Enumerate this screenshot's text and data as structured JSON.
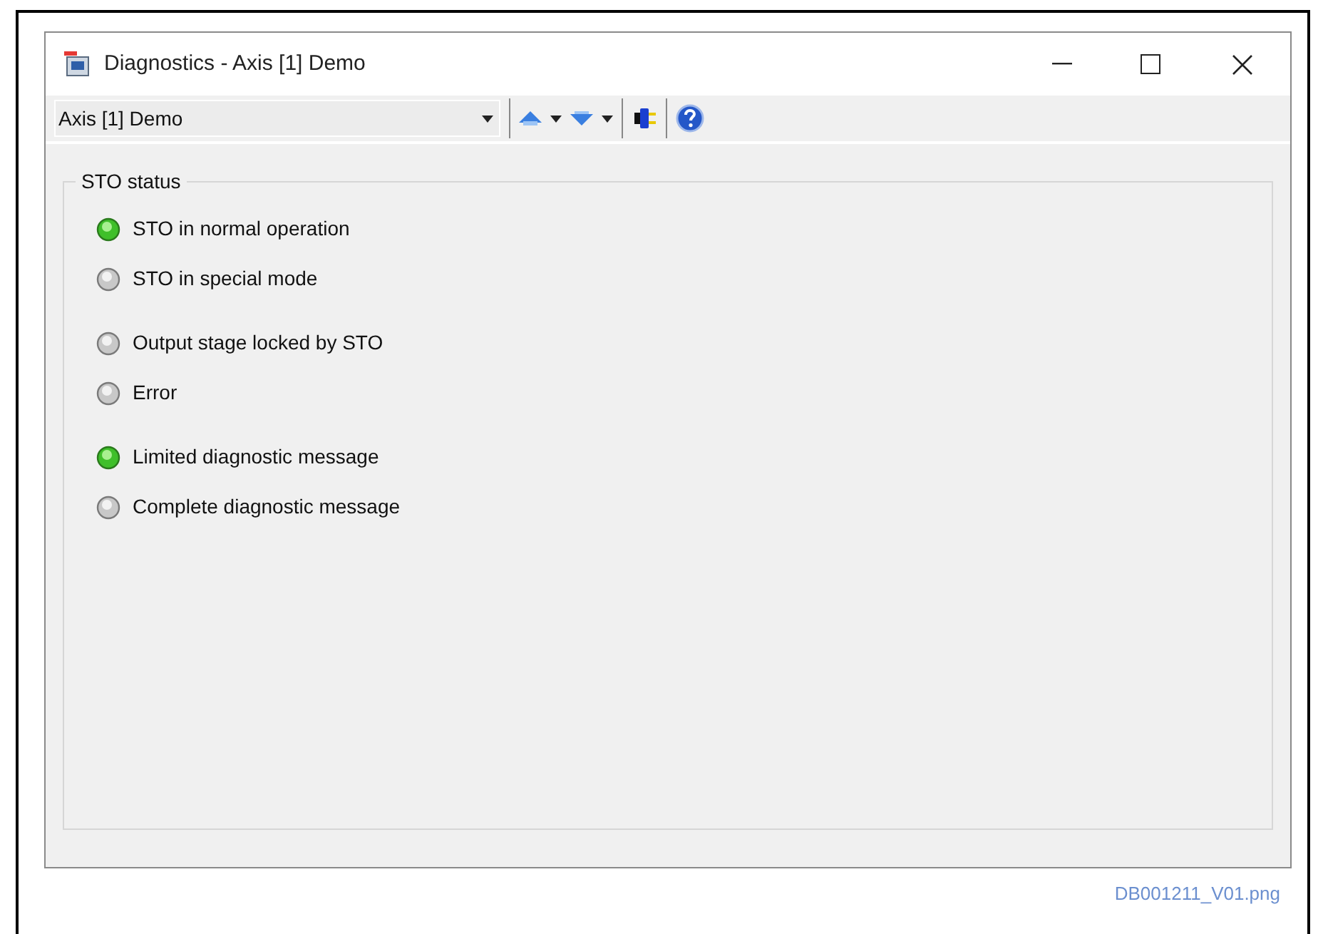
{
  "window": {
    "title": "Diagnostics - Axis [1] Demo"
  },
  "toolbar": {
    "axis_select": {
      "value": "Axis [1] Demo"
    }
  },
  "sto_status": {
    "title": "STO status",
    "groups": [
      {
        "indicators": [
          {
            "label": "STO in normal operation",
            "on": true
          },
          {
            "label": "STO in special mode",
            "on": false
          }
        ]
      },
      {
        "indicators": [
          {
            "label": "Output stage locked by STO",
            "on": false
          },
          {
            "label": "Error",
            "on": false
          }
        ]
      },
      {
        "indicators": [
          {
            "label": "Limited diagnostic message",
            "on": true
          },
          {
            "label": "Complete diagnostic message",
            "on": false
          }
        ]
      }
    ]
  },
  "caption": "DB001211_V01.png"
}
